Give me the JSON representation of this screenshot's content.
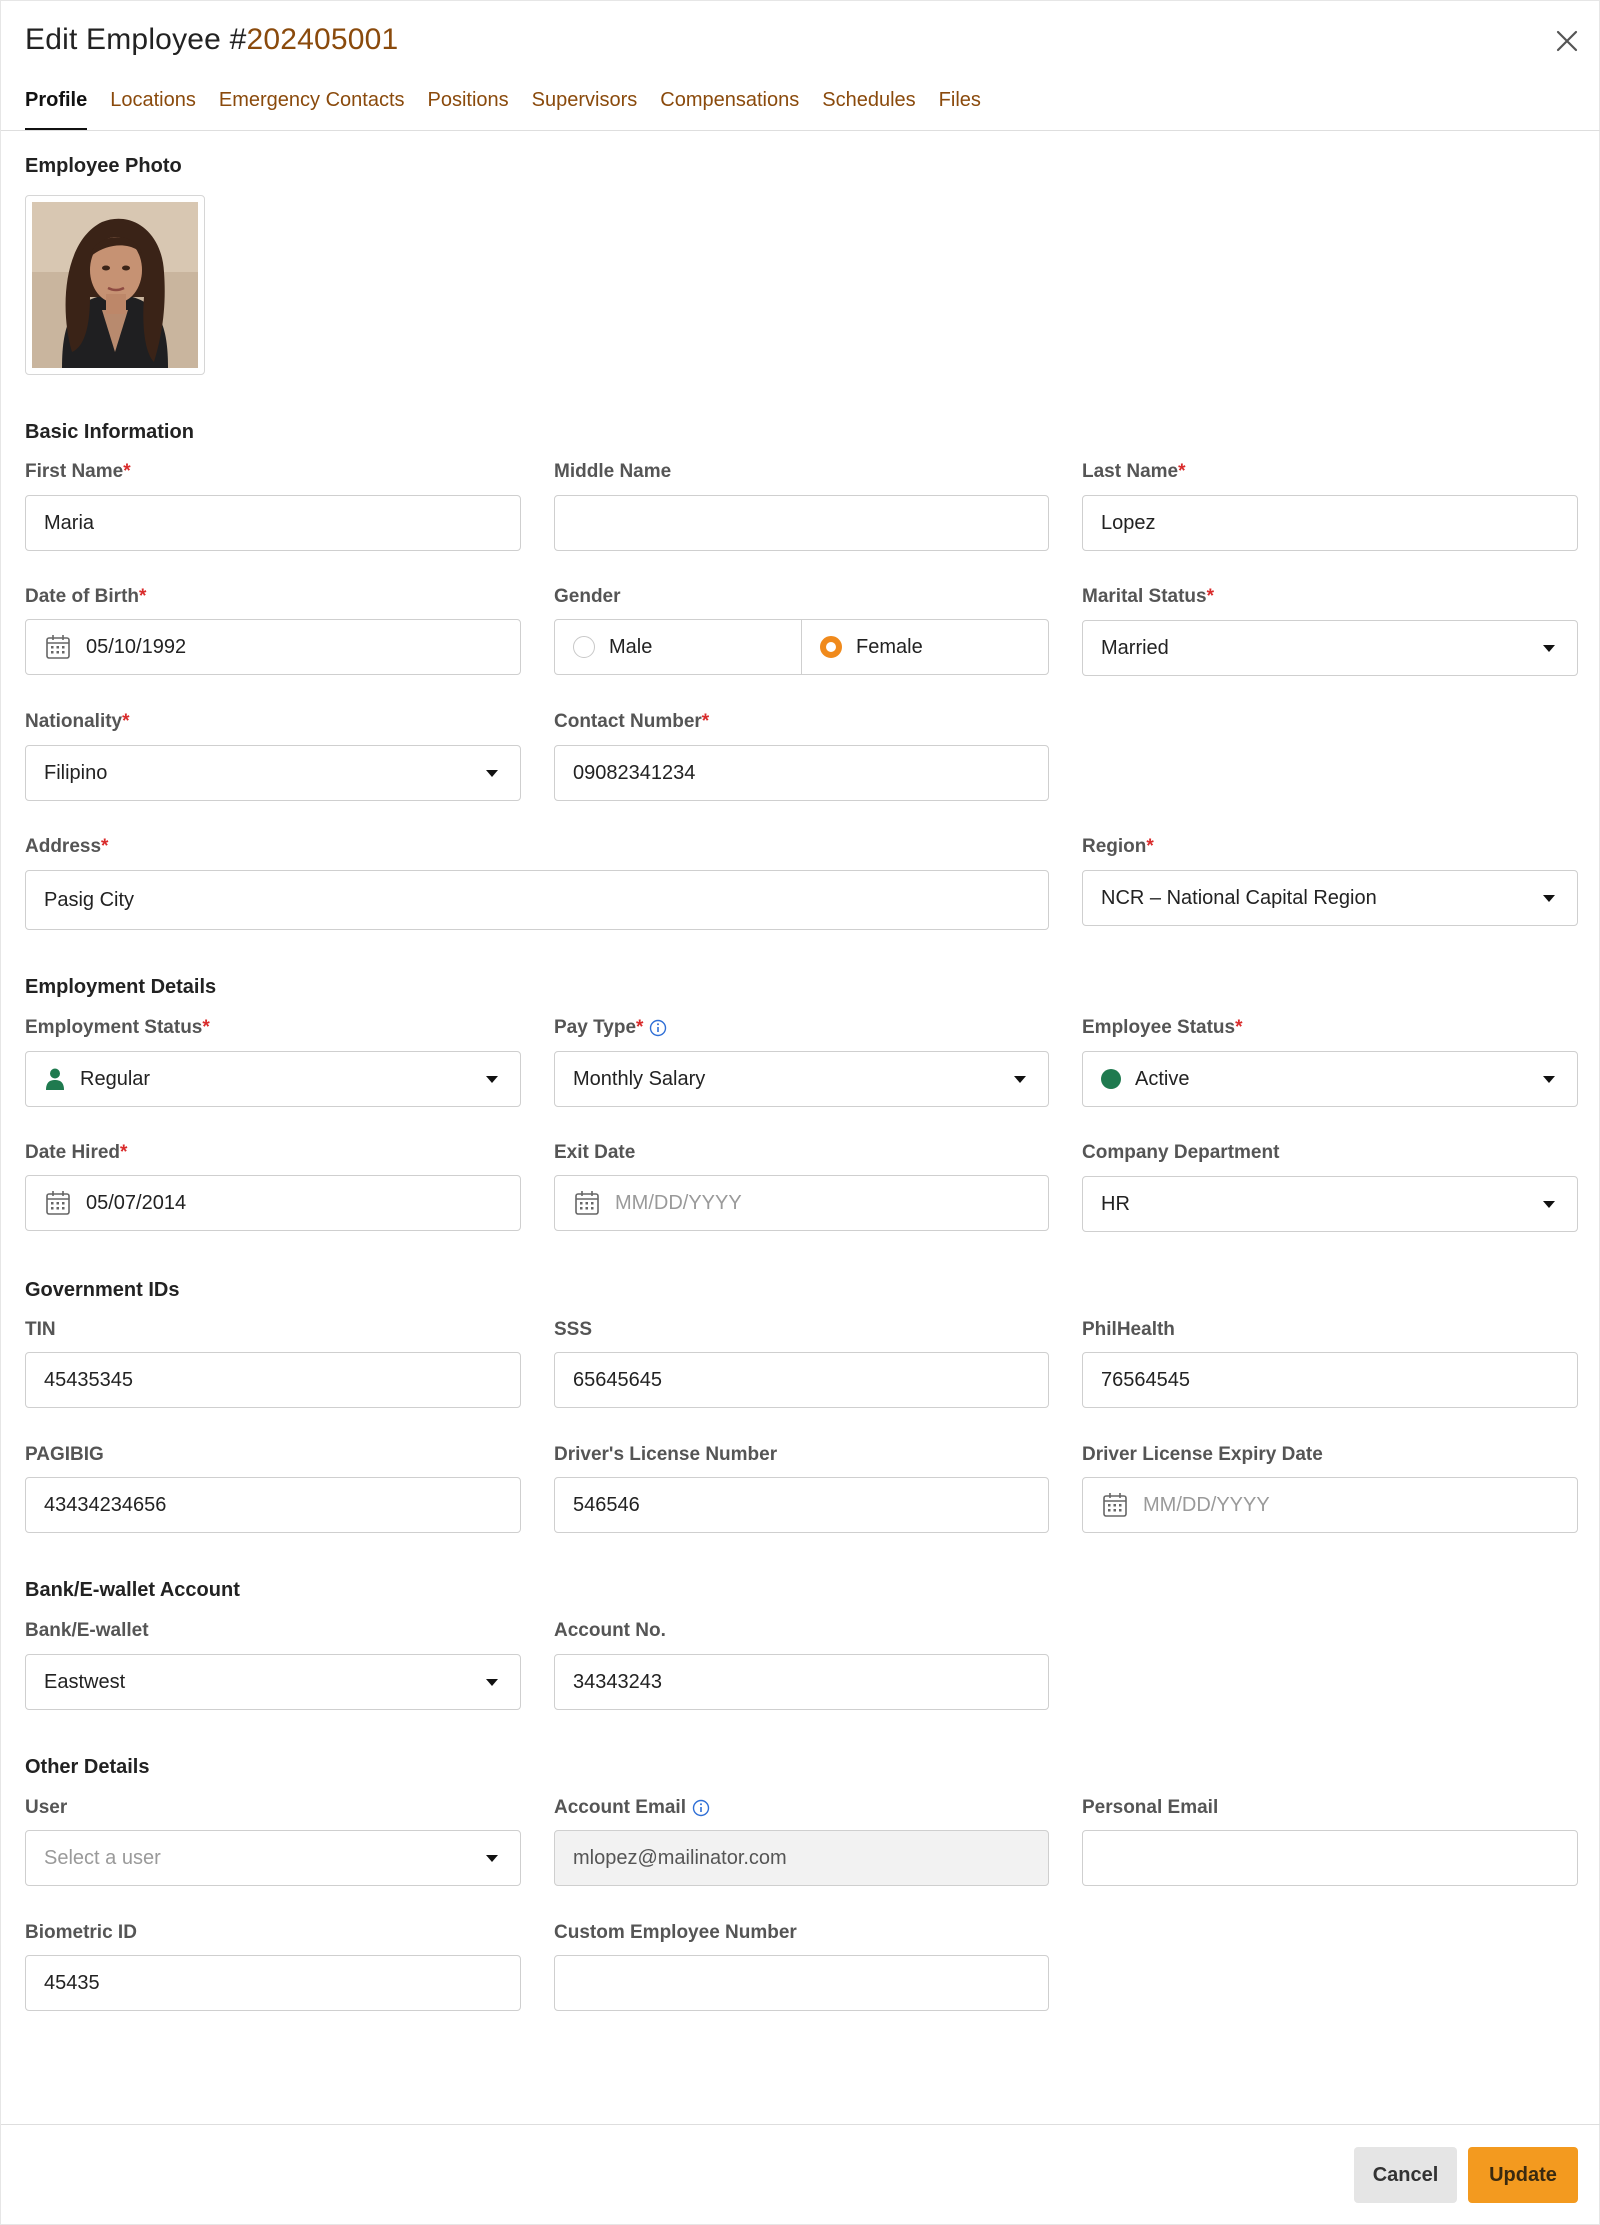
{
  "header": {
    "title_prefix": "Edit Employee #",
    "employee_number": "202405001"
  },
  "tabs": [
    {
      "label": "Profile",
      "active": true
    },
    {
      "label": "Locations"
    },
    {
      "label": "Emergency Contacts"
    },
    {
      "label": "Positions"
    },
    {
      "label": "Supervisors"
    },
    {
      "label": "Compensations"
    },
    {
      "label": "Schedules"
    },
    {
      "label": "Files"
    }
  ],
  "photo": {
    "label": "Employee Photo"
  },
  "basic": {
    "section": "Basic Information",
    "first_name": {
      "label": "First Name",
      "value": "Maria"
    },
    "middle_name": {
      "label": "Middle Name",
      "value": ""
    },
    "last_name": {
      "label": "Last Name",
      "value": "Lopez"
    },
    "dob": {
      "label": "Date of Birth",
      "value": "05/10/1992"
    },
    "gender": {
      "label": "Gender",
      "options": [
        "Male",
        "Female"
      ],
      "selected": "Female"
    },
    "marital": {
      "label": "Marital Status",
      "value": "Married"
    },
    "nationality": {
      "label": "Nationality",
      "value": "Filipino"
    },
    "contact": {
      "label": "Contact Number",
      "value": "09082341234"
    },
    "address": {
      "label": "Address",
      "value": "Pasig City"
    },
    "region": {
      "label": "Region",
      "value": "NCR – National Capital Region"
    }
  },
  "employment": {
    "section": "Employment Details",
    "emp_status": {
      "label": "Employment Status",
      "value": "Regular"
    },
    "pay_type": {
      "label": "Pay Type",
      "value": "Monthly Salary"
    },
    "employee_status": {
      "label": "Employee Status",
      "value": "Active",
      "color": "#1f7a4f"
    },
    "date_hired": {
      "label": "Date Hired",
      "value": "05/07/2014"
    },
    "exit_date": {
      "label": "Exit Date",
      "placeholder": "MM/DD/YYYY"
    },
    "department": {
      "label": "Company Department",
      "value": "HR"
    }
  },
  "gov": {
    "section": "Government IDs",
    "tin": {
      "label": "TIN",
      "value": "45435345"
    },
    "sss": {
      "label": "SSS",
      "value": "65645645"
    },
    "philhealth": {
      "label": "PhilHealth",
      "value": "76564545"
    },
    "pagibig": {
      "label": "PAGIBIG",
      "value": "43434234656"
    },
    "license": {
      "label": "Driver's License Number",
      "value": "546546"
    },
    "license_expiry": {
      "label": "Driver License Expiry Date",
      "placeholder": "MM/DD/YYYY"
    }
  },
  "bank": {
    "section": "Bank/E-wallet Account",
    "bank": {
      "label": "Bank/E-wallet",
      "value": "Eastwest"
    },
    "account": {
      "label": "Account No.",
      "value": "34343243"
    }
  },
  "other": {
    "section": "Other Details",
    "user": {
      "label": "User",
      "placeholder": "Select a user"
    },
    "account_email": {
      "label": "Account Email",
      "value": "mlopez@mailinator.com"
    },
    "personal_email": {
      "label": "Personal Email",
      "value": ""
    },
    "biometric": {
      "label": "Biometric ID",
      "value": "45435"
    },
    "custom_number": {
      "label": "Custom Employee Number",
      "value": ""
    }
  },
  "footer": {
    "cancel": "Cancel",
    "update": "Update"
  },
  "colors": {
    "accent": "#f39a1f",
    "brand_text": "#8a4a0c",
    "required": "#d92b2b",
    "active_status": "#1f7a4f"
  }
}
